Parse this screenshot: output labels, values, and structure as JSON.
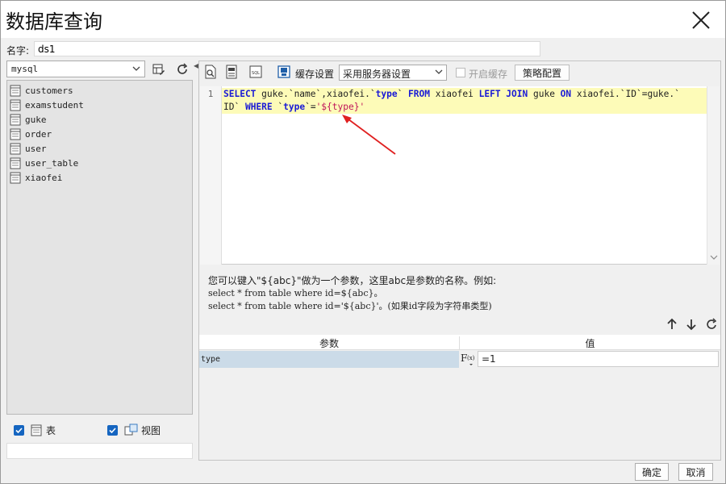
{
  "window": {
    "title": "数据库查询"
  },
  "name_field": {
    "label": "名字:",
    "value": "ds1"
  },
  "datasource": {
    "selected": "mysql",
    "tables": [
      "customers",
      "examstudent",
      "guke",
      "order",
      "user",
      "user_table",
      "xiaofei"
    ],
    "show_tables_label": "表",
    "show_views_label": "视图"
  },
  "toolbar": {
    "cache_label": "缓存设置",
    "cache_select": "采用服务器设置",
    "enable_cache_label": "开启缓存",
    "policy_button": "策略配置"
  },
  "editor": {
    "line_number": "1",
    "tokens_line1": [
      {
        "t": "SELECT",
        "c": "kw"
      },
      {
        "t": " guke.`name`,xiaofei.`",
        "c": ""
      },
      {
        "t": "type",
        "c": "kw"
      },
      {
        "t": "` ",
        "c": ""
      },
      {
        "t": "FROM",
        "c": "kw"
      },
      {
        "t": " xiaofei ",
        "c": ""
      },
      {
        "t": "LEFT JOIN",
        "c": "kw"
      },
      {
        "t": " guke ",
        "c": ""
      },
      {
        "t": "ON",
        "c": "kw"
      },
      {
        "t": " xiaofei.`ID`=guke.`",
        "c": ""
      }
    ],
    "tokens_line2": [
      {
        "t": "ID` ",
        "c": ""
      },
      {
        "t": "WHERE",
        "c": "kw"
      },
      {
        "t": " `",
        "c": ""
      },
      {
        "t": "type",
        "c": "kw"
      },
      {
        "t": "`=",
        "c": ""
      },
      {
        "t": "'${type}'",
        "c": "str"
      }
    ]
  },
  "hint": {
    "line1": "您可以键入\"${abc}\"做为一个参数，这里abc是参数的名称。例如:",
    "line2": "select * from table where id=${abc}。",
    "line3": "select * from table where id='${abc}'。(如果id字段为字符串类型)"
  },
  "params": {
    "col_param": "参数",
    "col_value": "值",
    "rows": [
      {
        "name": "type",
        "value": "=1"
      }
    ]
  },
  "footer": {
    "ok": "确定",
    "cancel": "取消"
  },
  "colors": {
    "accent": "#1565c0",
    "keyword": "#1a1ad6",
    "string": "#c0145a",
    "highlight": "#fdfbb8",
    "annotation_arrow": "#e02020"
  }
}
